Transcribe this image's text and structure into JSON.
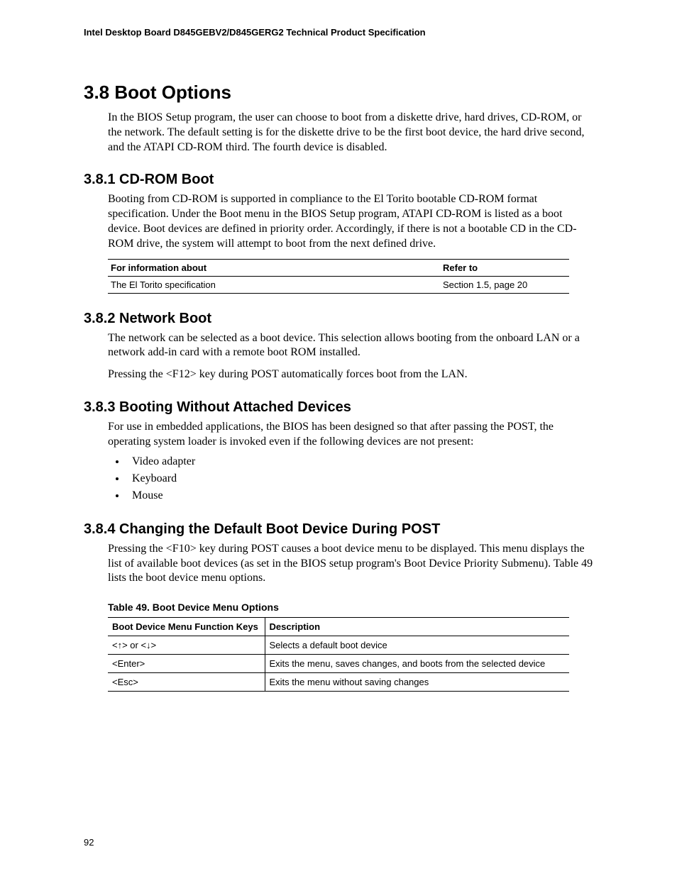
{
  "header": "Intel Desktop Board D845GEBV2/D845GERG2 Technical Product Specification",
  "page_number": "92",
  "s38": {
    "heading": "3.8  Boot Options",
    "p1": "In the BIOS Setup program, the user can choose to boot from a diskette drive, hard drives, CD-ROM, or the network.  The default setting is for the diskette drive to be the first boot device, the hard drive second, and the ATAPI CD-ROM third.  The fourth device is disabled."
  },
  "s381": {
    "heading": "3.8.1   CD-ROM Boot",
    "p1": "Booting from CD-ROM is supported in compliance to the El Torito bootable CD-ROM format specification.  Under the Boot menu in the BIOS Setup program, ATAPI CD-ROM is listed as a boot device.  Boot devices are defined in priority order.  Accordingly, if there is not a bootable CD in the CD-ROM drive, the system will attempt to boot from the next defined drive.",
    "ref_table": {
      "col_about": "For information about",
      "col_refer": "Refer to",
      "row1_about": "The El Torito specification",
      "row1_refer": "Section 1.5, page 20"
    }
  },
  "s382": {
    "heading": "3.8.2   Network Boot",
    "p1": "The network can be selected as a boot device.  This selection allows booting from the onboard LAN or a network add-in card with a remote boot ROM installed.",
    "p2": "Pressing the <F12> key during POST automatically forces boot from the LAN."
  },
  "s383": {
    "heading": "3.8.3   Booting Without Attached Devices",
    "p1": "For use in embedded applications, the BIOS has been designed so that after passing the POST, the operating system loader is invoked even if the following devices are not present:",
    "items": [
      "Video adapter",
      "Keyboard",
      "Mouse"
    ]
  },
  "s384": {
    "heading": "3.8.4   Changing the Default Boot Device During POST",
    "p1": "Pressing the <F10> key during POST causes a boot device menu to be displayed.  This menu displays the list of available boot devices (as set in the BIOS setup program's Boot Device Priority Submenu).  Table 49 lists the boot device menu options.",
    "table_caption": "Table 49.    Boot Device Menu Options",
    "table": {
      "col_keys": "Boot Device Menu Function Keys",
      "col_desc": "Description",
      "rows": [
        {
          "key": "<↑> or <↓>",
          "desc": "Selects a default boot device"
        },
        {
          "key": "<Enter>",
          "desc": "Exits the menu, saves changes, and boots from the selected device"
        },
        {
          "key": "<Esc>",
          "desc": "Exits the menu without saving changes"
        }
      ]
    }
  }
}
